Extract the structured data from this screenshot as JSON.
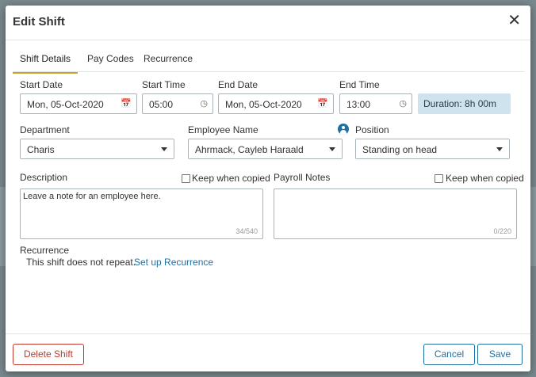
{
  "modal": {
    "title": "Edit Shift",
    "close_glyph": "✕"
  },
  "tabs": [
    {
      "label": "Shift Details",
      "active": true
    },
    {
      "label": "Pay Codes",
      "active": false
    },
    {
      "label": "Recurrence",
      "active": false
    }
  ],
  "form": {
    "start_date": {
      "label": "Start Date",
      "value": "Mon, 05-Oct-2020",
      "icon": "calendar-icon"
    },
    "start_time": {
      "label": "Start Time",
      "value": "05:00",
      "icon": "clock-icon"
    },
    "end_date": {
      "label": "End Date",
      "value": "Mon, 05-Oct-2020",
      "icon": "calendar-icon"
    },
    "end_time": {
      "label": "End Time",
      "value": "13:00",
      "icon": "clock-icon"
    },
    "duration": "Duration: 8h 00m",
    "department": {
      "label": "Department",
      "value": "Charis"
    },
    "employee": {
      "label": "Employee Name",
      "value": "Ahrmack, Cayleb Haraald"
    },
    "position": {
      "label": "Position",
      "value": "Standing on head",
      "icon": "person-icon"
    },
    "description": {
      "label": "Description",
      "keep_label": "Keep when copied",
      "value": "Leave a note for an employee here.",
      "counter": "34/540"
    },
    "payroll_notes": {
      "label": "Payroll Notes",
      "keep_label": "Keep when copied",
      "value": "",
      "counter": "0/220"
    },
    "recurrence": {
      "label": "Recurrence",
      "text": "This shift does not repeat.",
      "link": "Set up Recurrence"
    }
  },
  "footer": {
    "delete_label": "Delete Shift",
    "cancel_label": "Cancel",
    "save_label": "Save"
  },
  "colors": {
    "accent": "#1f6fa3",
    "tab_underline": "#c9a227",
    "danger": "#c0392b",
    "duration_bg": "#cfe3ee"
  }
}
